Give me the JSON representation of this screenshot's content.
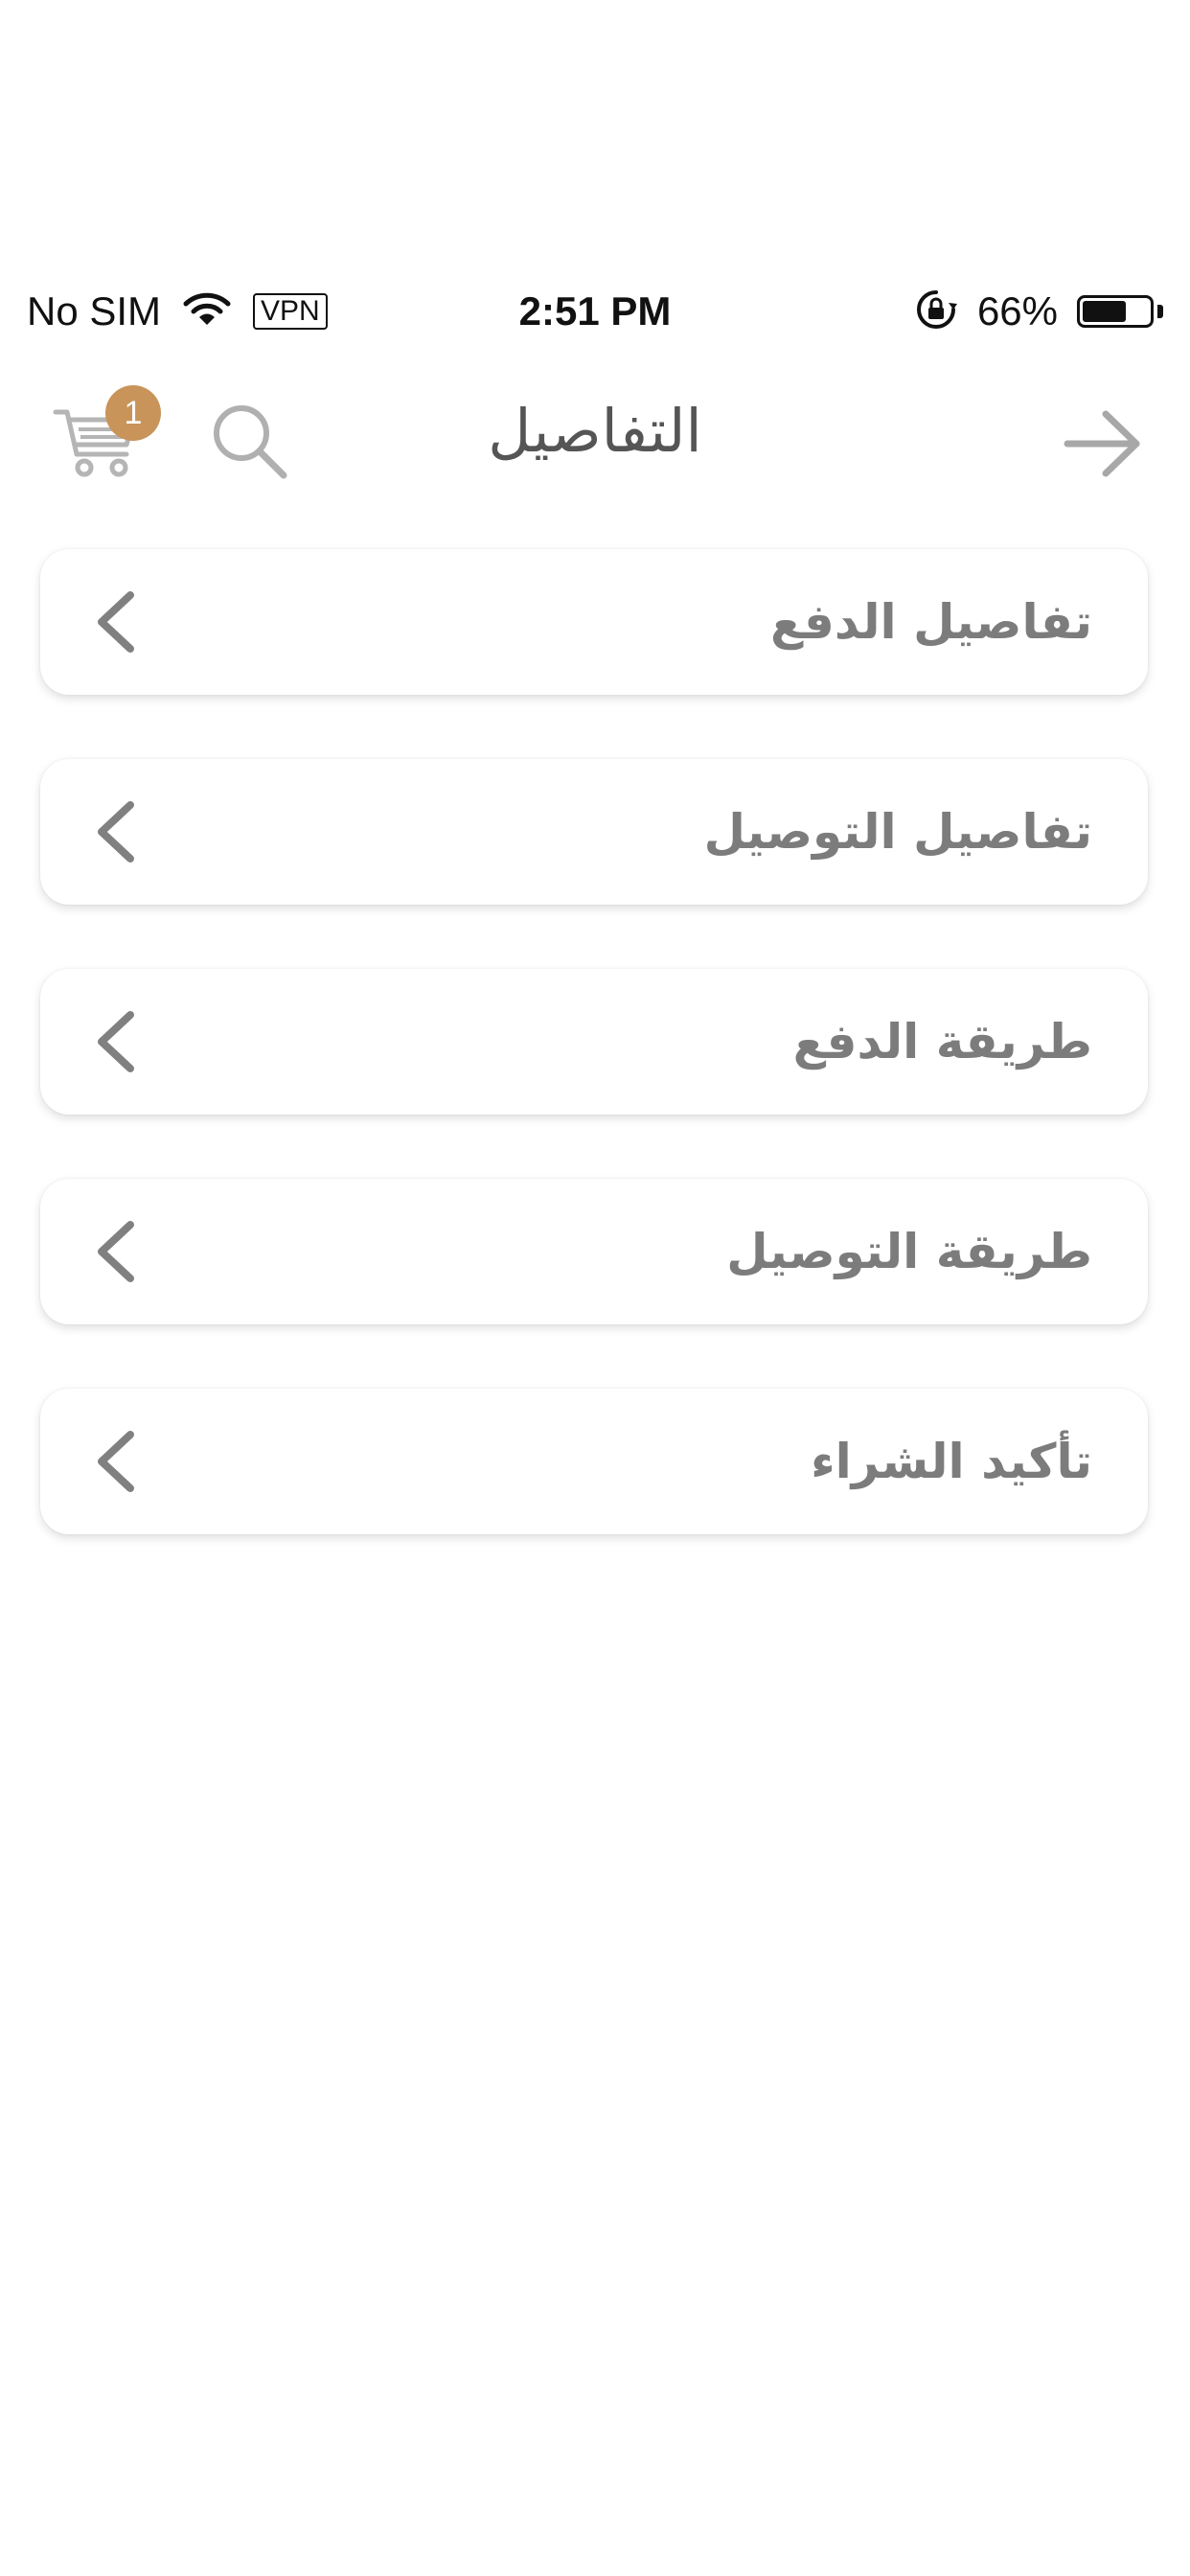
{
  "status_bar": {
    "carrier": "No SIM",
    "vpn": "VPN",
    "time": "2:51 PM",
    "battery_percent": "66%",
    "battery_level": 0.66
  },
  "header": {
    "title": "التفاصيل",
    "cart_count": "1",
    "badge_color": "#c8945a"
  },
  "items": [
    {
      "label": "تفاصيل الدفع"
    },
    {
      "label": "تفاصيل التوصيل"
    },
    {
      "label": "طريقة الدفع"
    },
    {
      "label": "طريقة التوصيل"
    },
    {
      "label": "تأكيد الشراء"
    }
  ],
  "icons": {
    "cart": "cart-icon",
    "search": "search-icon",
    "back": "arrow-right-icon",
    "chevron": "chevron-left-icon"
  }
}
